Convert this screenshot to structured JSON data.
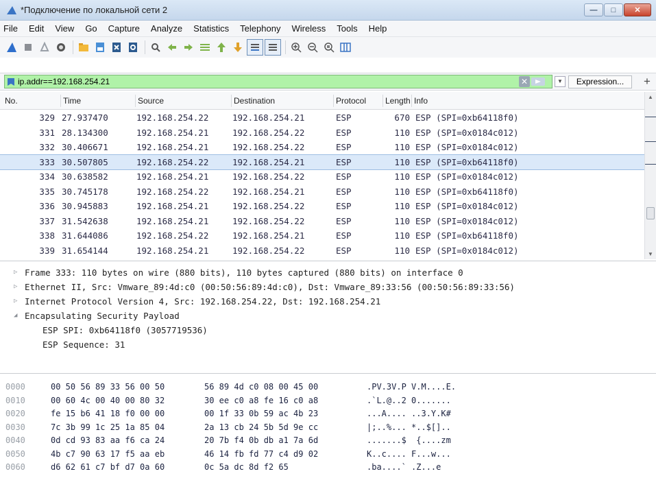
{
  "window": {
    "title": "*Подключение по локальной сети 2",
    "controls": [
      "minimize",
      "maximize",
      "close"
    ]
  },
  "menu": [
    "File",
    "Edit",
    "View",
    "Go",
    "Capture",
    "Analyze",
    "Statistics",
    "Telephony",
    "Wireless",
    "Tools",
    "Help"
  ],
  "toolbar": {
    "icons": [
      "shark-fin-start-icon",
      "stop-square-icon",
      "restart-icon",
      "options-gear-icon",
      "open-folder-icon",
      "save-file-icon",
      "close-file-icon",
      "reload-file-icon",
      "find-packet-icon",
      "go-back-icon",
      "go-forward-icon",
      "go-to-packet-icon",
      "go-first-icon",
      "go-last-icon",
      "autoscroll-icon",
      "colorize-icon",
      "zoom-in-icon",
      "zoom-out-icon",
      "zoom-normal-icon",
      "resize-columns-icon"
    ]
  },
  "filter": {
    "value": "ip.addr==192.168.254.21",
    "expression_label": "Expression...",
    "add_label": "+"
  },
  "packet_list": {
    "columns": [
      "No.",
      "Time",
      "Source",
      "Destination",
      "Protocol",
      "Length",
      "Info"
    ],
    "rows": [
      {
        "no": "329",
        "time": "27.937470",
        "src": "192.168.254.22",
        "dst": "192.168.254.21",
        "proto": "ESP",
        "len": "670",
        "info": "ESP (SPI=0xb64118f0)",
        "selected": false
      },
      {
        "no": "331",
        "time": "28.134300",
        "src": "192.168.254.21",
        "dst": "192.168.254.22",
        "proto": "ESP",
        "len": "110",
        "info": "ESP (SPI=0x0184c012)",
        "selected": false
      },
      {
        "no": "332",
        "time": "30.406671",
        "src": "192.168.254.21",
        "dst": "192.168.254.22",
        "proto": "ESP",
        "len": "110",
        "info": "ESP (SPI=0x0184c012)",
        "selected": false
      },
      {
        "no": "333",
        "time": "30.507805",
        "src": "192.168.254.22",
        "dst": "192.168.254.21",
        "proto": "ESP",
        "len": "110",
        "info": "ESP (SPI=0xb64118f0)",
        "selected": true
      },
      {
        "no": "334",
        "time": "30.638582",
        "src": "192.168.254.21",
        "dst": "192.168.254.22",
        "proto": "ESP",
        "len": "110",
        "info": "ESP (SPI=0x0184c012)",
        "selected": false
      },
      {
        "no": "335",
        "time": "30.745178",
        "src": "192.168.254.22",
        "dst": "192.168.254.21",
        "proto": "ESP",
        "len": "110",
        "info": "ESP (SPI=0xb64118f0)",
        "selected": false
      },
      {
        "no": "336",
        "time": "30.945883",
        "src": "192.168.254.21",
        "dst": "192.168.254.22",
        "proto": "ESP",
        "len": "110",
        "info": "ESP (SPI=0x0184c012)",
        "selected": false
      },
      {
        "no": "337",
        "time": "31.542638",
        "src": "192.168.254.21",
        "dst": "192.168.254.22",
        "proto": "ESP",
        "len": "110",
        "info": "ESP (SPI=0x0184c012)",
        "selected": false
      },
      {
        "no": "338",
        "time": "31.644086",
        "src": "192.168.254.22",
        "dst": "192.168.254.21",
        "proto": "ESP",
        "len": "110",
        "info": "ESP (SPI=0xb64118f0)",
        "selected": false
      },
      {
        "no": "339",
        "time": "31.654144",
        "src": "192.168.254.21",
        "dst": "192.168.254.22",
        "proto": "ESP",
        "len": "110",
        "info": "ESP (SPI=0x0184c012)",
        "selected": false
      }
    ]
  },
  "details": [
    {
      "text": "Frame 333: 110 bytes on wire (880 bits), 110 bytes captured (880 bits) on interface 0",
      "expanded": false,
      "indent": 0
    },
    {
      "text": "Ethernet II, Src: Vmware_89:4d:c0 (00:50:56:89:4d:c0), Dst: Vmware_89:33:56 (00:50:56:89:33:56)",
      "expanded": false,
      "indent": 0
    },
    {
      "text": "Internet Protocol Version 4, Src: 192.168.254.22, Dst: 192.168.254.21",
      "expanded": false,
      "indent": 0
    },
    {
      "text": "Encapsulating Security Payload",
      "expanded": true,
      "indent": 0
    },
    {
      "text": "ESP SPI: 0xb64118f0 (3057719536)",
      "expanded": null,
      "indent": 1
    },
    {
      "text": "ESP Sequence: 31",
      "expanded": null,
      "indent": 1
    }
  ],
  "bytes": [
    {
      "offset": "0000",
      "hex1": "00 50 56 89 33 56 00 50",
      "hex2": "56 89 4d c0 08 00 45 00",
      "ascii": ".PV.3V.P V.M....E."
    },
    {
      "offset": "0010",
      "hex1": "00 60 4c 00 40 00 80 32",
      "hex2": "30 ee c0 a8 fe 16 c0 a8",
      "ascii": ".`L.@..2 0......."
    },
    {
      "offset": "0020",
      "hex1": "fe 15 b6 41 18 f0 00 00",
      "hex2": "00 1f 33 0b 59 ac 4b 23",
      "ascii": "...A.... ..3.Y.K#"
    },
    {
      "offset": "0030",
      "hex1": "7c 3b 99 1c 25 1a 85 04",
      "hex2": "2a 13 cb 24 5b 5d 9e cc",
      "ascii": "|;..%... *..$[].."
    },
    {
      "offset": "0040",
      "hex1": "0d cd 93 83 aa f6 ca 24",
      "hex2": "20 7b f4 0b db a1 7a 6d",
      "ascii": ".......$  {....zm"
    },
    {
      "offset": "0050",
      "hex1": "4b c7 90 63 17 f5 aa eb",
      "hex2": "46 14 fb fd 77 c4 d9 02",
      "ascii": "K..c.... F...w..."
    },
    {
      "offset": "0060",
      "hex1": "d6 62 61 c7 bf d7 0a 60",
      "hex2": "0c 5a dc 8d f2 65",
      "ascii": ".ba....` .Z...e"
    }
  ],
  "colors": {
    "filter_bg": "#b0f2a8",
    "selected_row": "#dbe9f9",
    "title_bar": "#c5d7ec"
  }
}
